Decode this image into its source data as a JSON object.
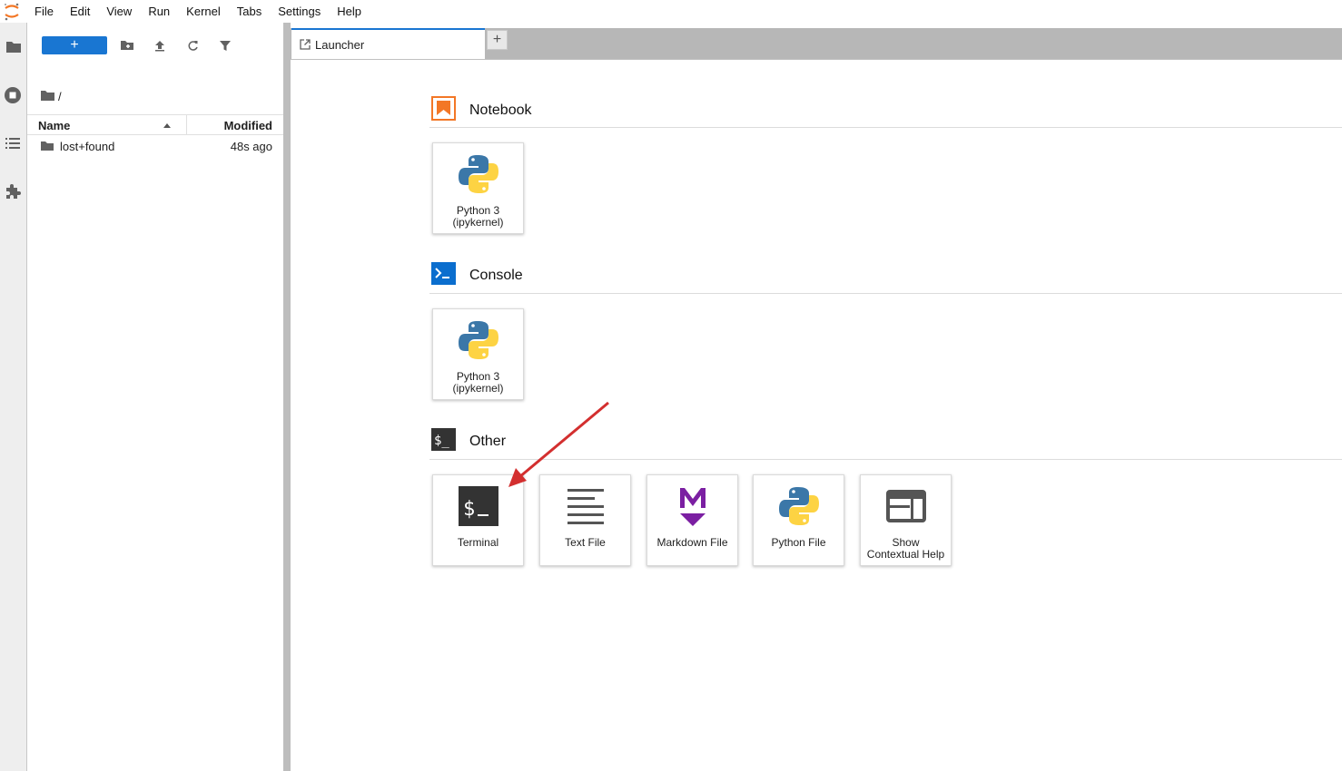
{
  "menubar": {
    "items": [
      "File",
      "Edit",
      "View",
      "Run",
      "Kernel",
      "Tabs",
      "Settings",
      "Help"
    ]
  },
  "activity_bar": {
    "icons": [
      "folder-icon",
      "running-icon",
      "toc-icon",
      "extension-icon"
    ]
  },
  "file_browser": {
    "new_label": "+",
    "breadcrumb": "/",
    "columns": {
      "name": "Name",
      "modified": "Modified"
    },
    "files": [
      {
        "name": "lost+found",
        "modified": "48s ago",
        "type": "folder"
      }
    ]
  },
  "tabs": {
    "items": [
      {
        "label": "Launcher"
      }
    ],
    "add_label": "+"
  },
  "launcher": {
    "sections": [
      {
        "title": "Notebook",
        "cards": [
          {
            "label": "Python 3\n(ipykernel)",
            "icon": "python-icon"
          }
        ]
      },
      {
        "title": "Console",
        "cards": [
          {
            "label": "Python 3\n(ipykernel)",
            "icon": "python-icon"
          }
        ]
      },
      {
        "title": "Other",
        "cards": [
          {
            "label": "Terminal",
            "icon": "terminal-icon"
          },
          {
            "label": "Text File",
            "icon": "text-file-icon"
          },
          {
            "label": "Markdown File",
            "icon": "markdown-icon"
          },
          {
            "label": "Python File",
            "icon": "python-icon"
          },
          {
            "label": "Show\nContextual Help",
            "icon": "contextual-help-icon"
          }
        ]
      }
    ]
  },
  "colors": {
    "accent": "#1976d2",
    "notebook": "#f37726",
    "console": "#0b6ece",
    "markdown": "#7b1fa2",
    "annotation_arrow": "#d32f2f"
  }
}
